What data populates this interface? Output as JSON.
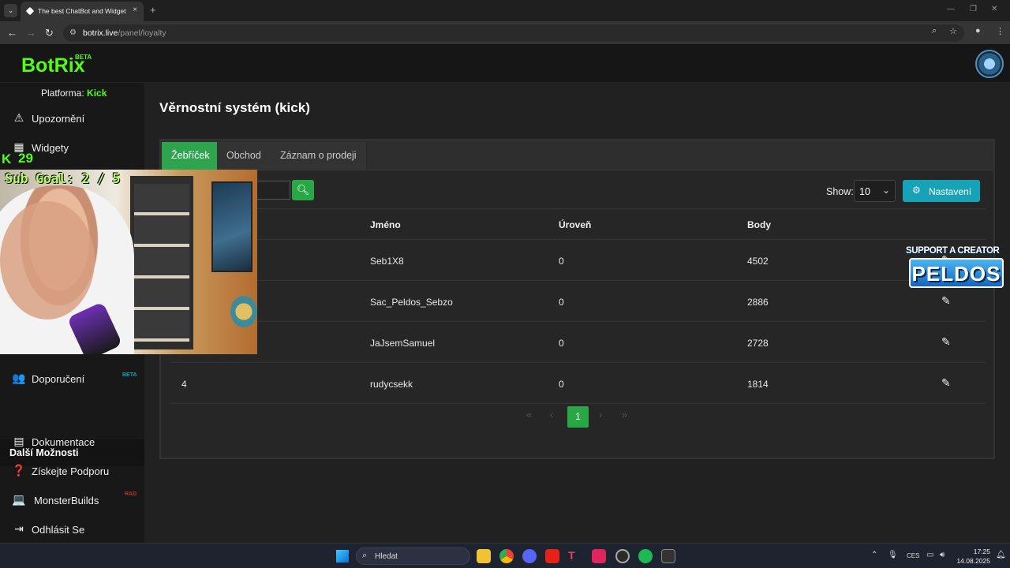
{
  "browser": {
    "tab_title": "The best ChatBot and Widgets",
    "tab_close": "×",
    "new_tab": "+",
    "url_host": "botrix.live",
    "url_path": "/panel/loyalty"
  },
  "app": {
    "logo": "BotRix",
    "logo_badge": "BETA",
    "platform_label": "Platforma:",
    "platform_value": "Kick"
  },
  "sidebar": {
    "items": [
      {
        "label": "Upozornění",
        "icon": "warning-icon"
      },
      {
        "label": "Widgety",
        "icon": "grid-icon"
      },
      {
        "label": "Doporučení",
        "icon": "users-icon",
        "badge": "BETA"
      }
    ],
    "section_title": "Další Možnosti",
    "more_items": [
      {
        "label": "Dokumentace",
        "icon": "book-icon"
      },
      {
        "label": "Získejte Podporu",
        "icon": "question-icon"
      },
      {
        "label": "MonsterBuilds",
        "icon": "laptop-icon",
        "badge": "RAD"
      },
      {
        "label": "Odhlásit Se",
        "icon": "logout-icon"
      }
    ]
  },
  "page": {
    "title": "Věrnostní systém (kick)",
    "tabs": [
      {
        "label": "Žebříček",
        "active": true
      },
      {
        "label": "Obchod",
        "active": false
      },
      {
        "label": "Záznam o prodeji",
        "active": false
      }
    ],
    "show_label": "Show:",
    "show_value": "10",
    "settings_label": "Nastavení"
  },
  "table": {
    "headers": [
      "Jméno",
      "Úroveň",
      "Body"
    ],
    "rows": [
      {
        "rank": "",
        "name": "Seb1X8",
        "level": "0",
        "points": "4502"
      },
      {
        "rank": "",
        "name": "Sac_Peldos_Sebzo",
        "level": "0",
        "points": "2886"
      },
      {
        "rank": "",
        "name": "JaJsemSamuel",
        "level": "0",
        "points": "2728"
      },
      {
        "rank": "4",
        "name": "rudycsekk",
        "level": "0",
        "points": "1814"
      }
    ]
  },
  "pagination": {
    "first": "«",
    "prev": "‹",
    "current": "1",
    "next": "›",
    "last": "»"
  },
  "overlay": {
    "sub_count": "29",
    "sub_goal": "Sub Goal: 2 / 5",
    "creator_top": "SUPPORT A CREATOR",
    "creator_name": "PELDOS"
  },
  "taskbar": {
    "search_label": "Hledat",
    "lang": "CES",
    "time": "17:25",
    "date": "14.08.2025"
  },
  "colors": {
    "brand_green": "#53fc18",
    "accent_green": "#28a745",
    "info_teal": "#17a2b8"
  }
}
